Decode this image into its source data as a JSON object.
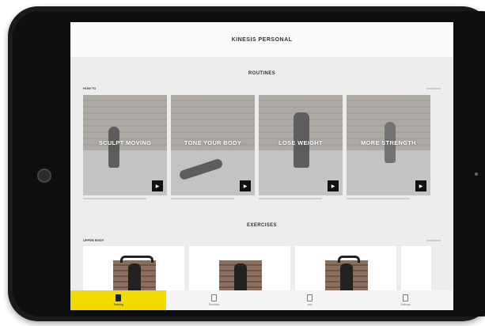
{
  "app": {
    "title": "KINESIS PERSONAL"
  },
  "routines": {
    "section_title": "ROUTINES",
    "subsection_label": "HOW TO",
    "items": [
      {
        "label": "SCULPT MOVING"
      },
      {
        "label": "TONE YOUR BODY"
      },
      {
        "label": "LOSE WEIGHT"
      },
      {
        "label": "MORE STRENGTH"
      }
    ]
  },
  "exercises": {
    "section_title": "EXERCISES",
    "subsection_label": "UPPER BODY"
  },
  "tabs": [
    {
      "label": "Training",
      "active": true
    },
    {
      "label": "Routines",
      "active": false
    },
    {
      "label": "Info",
      "active": false
    },
    {
      "label": "Settings",
      "active": false
    }
  ],
  "colors": {
    "accent": "#f2dc00",
    "frame": "#1a1a1a"
  }
}
